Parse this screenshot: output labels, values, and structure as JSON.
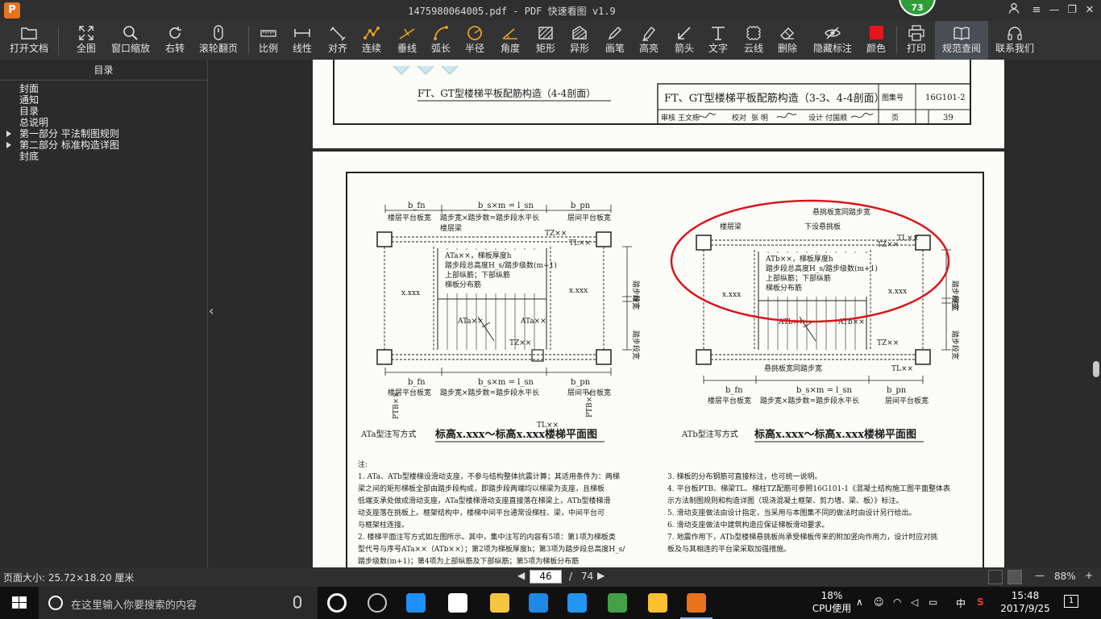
{
  "window": {
    "title": "1475980064005.pdf - PDF 快速看图 v1.9",
    "badge": "73",
    "logo": "P"
  },
  "toolbar": {
    "items": [
      {
        "label": "打开文档",
        "icon": "folder-icon"
      },
      {
        "label": "全图",
        "icon": "fullscreen-icon"
      },
      {
        "label": "窗口缩放",
        "icon": "magnifier-icon"
      },
      {
        "label": "右转",
        "icon": "rotate-icon"
      },
      {
        "label": "滚轮翻页",
        "icon": "mouse-icon"
      },
      {
        "label": "比例",
        "icon": "scale-icon"
      },
      {
        "label": "线性",
        "icon": "linear-icon"
      },
      {
        "label": "对齐",
        "icon": "align-icon"
      },
      {
        "label": "连续",
        "icon": "continuous-icon"
      },
      {
        "label": "垂线",
        "icon": "perpendicular-icon"
      },
      {
        "label": "弧长",
        "icon": "arc-length-icon"
      },
      {
        "label": "半径",
        "icon": "radius-icon"
      },
      {
        "label": "角度",
        "icon": "angle-icon"
      },
      {
        "label": "矩形",
        "icon": "rectangle-icon"
      },
      {
        "label": "异形",
        "icon": "polygon-icon"
      },
      {
        "label": "画笔",
        "icon": "pen-icon"
      },
      {
        "label": "高亮",
        "icon": "highlighter-icon"
      },
      {
        "label": "箭头",
        "icon": "arrow-icon"
      },
      {
        "label": "文字",
        "icon": "text-icon"
      },
      {
        "label": "云线",
        "icon": "cloud-icon"
      },
      {
        "label": "删除",
        "icon": "eraser-icon"
      },
      {
        "label": "隐藏标注",
        "icon": "hide-eye-icon"
      },
      {
        "label": "颜色",
        "icon": "color-swatch-icon"
      },
      {
        "label": "打印",
        "icon": "printer-icon"
      },
      {
        "label": "规范查阅",
        "icon": "book-icon"
      },
      {
        "label": "联系我们",
        "icon": "headset-icon"
      }
    ],
    "swatch_color": "#e8141c"
  },
  "outline": {
    "header": "目录",
    "items": [
      {
        "label": "封面",
        "expandable": false
      },
      {
        "label": "通知",
        "expandable": false
      },
      {
        "label": "目录",
        "expandable": false
      },
      {
        "label": "总说明",
        "expandable": false
      },
      {
        "label": "第一部分  平法制图规则",
        "expandable": true
      },
      {
        "label": "第二部分  标准构造详图",
        "expandable": true
      },
      {
        "label": "封底",
        "expandable": false
      }
    ]
  },
  "page1": {
    "caption": "FT、GT型楼梯平板配筋构造（4-4剖面）",
    "title_block": {
      "title": "FT、GT型楼梯平板配筋构造（3-3、4-4剖面）",
      "atlas_label": "图集号",
      "atlas_no": "16G101-2",
      "page_label": "页",
      "page_no": "39",
      "sig_labels": [
        "审核",
        "王文栋",
        "校对",
        "张  明",
        "设计",
        "付国顺"
      ]
    }
  },
  "page2": {
    "left_plan": {
      "b_top_left": "b_fn",
      "b_top_mid": "b_s×m = l_sn",
      "b_top_right": "b_pn",
      "lbl_floor": "楼层平台板宽",
      "lbl_step": "踏步宽×踏步数=踏步段水平长",
      "lbl_landing": "层间平台板宽",
      "lbl_beam": "楼层梁",
      "tz": "TZ××",
      "tl": "TL××",
      "spec1": "ATa××，梯板厚度h",
      "spec2": "踏步段总高度H_s/踏步级数(m+1)",
      "spec3": "上部纵筋；下部纵筋",
      "spec4": "梯板分布筋",
      "ptb": "PTB××",
      "xxx": "x.xxx",
      "ata": "ATa××",
      "xia": "下",
      "shang": "上",
      "right_step": "踏步段宽",
      "right_gap": "缝宽",
      "bot_floor": "楼层平台板宽",
      "bot_step": "踏步宽×踏步数=踏步段水平长",
      "bot_landing": "层间平台板宽"
    },
    "right_plan": {
      "top_note": "悬挑板宽同踏步宽",
      "beam": "楼层梁",
      "cant": "下设悬挑板",
      "spec1": "ATb××，梯板厚度h",
      "spec2": "踏步段总高度H_s/踏步级数(m+1)",
      "spec3": "上部纵筋；下部纵筋",
      "spec4": "梯板分布筋",
      "atb": "ATb××",
      "bot_note": "悬挑板宽同踏步宽",
      "bot_floor": "楼层平台板宽",
      "bot_step": "踏步宽×踏步数=踏步段水平长",
      "bot_landing": "层间平台板宽"
    },
    "left_caption_small": "ATa型注写方式",
    "left_caption": "标高x.xxx～标高x.xxx楼梯平面图",
    "right_caption_small": "ATb型注写方式",
    "right_caption": "标高x.xxx～标高x.xxx楼梯平面图",
    "notes_head": "注:",
    "notes_left": [
      "1. ATa、ATb型楼梯设滑动支座，不参与结构整体抗震计算；其适用条件为：两梯",
      "   梁之间的矩形梯板全部由踏步段构成，即踏步段两端均以梯梁为支座，且梯板",
      "   低端支承处做成滑动支座，ATa型楼梯滑动支座直接落在梯梁上，ATb型楼梯滑",
      "   动支座落在挑板上。框架结构中，楼梯中间平台通常设梯柱、梁，中间平台可",
      "   与框架柱连接。",
      "2. 楼梯平面注写方式如左图所示。其中，集中注写的内容有5项：第1项为梯板类",
      "   型代号与序号ATa××（ATb××）；第2项为梯板厚度h；第3项为踏步段总高度H_s/",
      "   踏步级数(m+1)；第4项为上部纵筋及下部纵筋；第5项为梯板分布筋"
    ],
    "notes_right": [
      "3. 梯板的分布钢筋可直接标注，也可统一说明。",
      "4. 平台板PTB、梯梁TL、梯柱TZ配筋可参照16G101-1《混凝土结构施工图平面整体表",
      "   示方法制图规则和构造详图（现浇混凝土框架、剪力墙、梁、板）》标注。",
      "5. 滑动支座做法由设计指定，当采用与本图集不同的做法时由设计另行给出。",
      "6. 滑动支座做法中建筑构造应保证梯板滑动要求。",
      "7. 地震作用下，ATb型楼梯悬挑板尚承受梯板传来的附加竖向作用力，设计时应对挑",
      "   板及与其相连的平台梁采取加强措施。"
    ],
    "annotation_color": "#d9161c"
  },
  "status": {
    "page_size": "页面大小: 25.72×18.20 厘米",
    "current_page": "46",
    "separator": "/",
    "total_pages": "74",
    "zoom": "88%",
    "zoom_out": "—",
    "zoom_in": "+",
    "prev": "◀",
    "next": "▶"
  },
  "taskbar": {
    "search_placeholder": "在这里输入你要搜索的内容",
    "cpu_percent": "18%",
    "cpu_label": "CPU使用",
    "ime": "中",
    "time": "15:48",
    "date": "2017/9/25",
    "notif_count": "1",
    "apps": [
      {
        "icon": "task-view-icon",
        "color": "#ffffff"
      },
      {
        "icon": "swirl-app-icon",
        "color": "#cccccc"
      },
      {
        "icon": "edge-icon",
        "color": "#1e90ff"
      },
      {
        "icon": "store-icon",
        "color": "#ffffff"
      },
      {
        "icon": "file-explorer-icon",
        "color": "#f5c542"
      },
      {
        "icon": "browser-g-icon",
        "color": "#1e88e5"
      },
      {
        "icon": "network-app-icon",
        "color": "#2196f3"
      },
      {
        "icon": "refresh-app-icon",
        "color": "#43a047"
      },
      {
        "icon": "notes-app-icon",
        "color": "#fbc02d"
      },
      {
        "icon": "pdf-viewer-icon",
        "color": "#e8731c"
      }
    ]
  }
}
